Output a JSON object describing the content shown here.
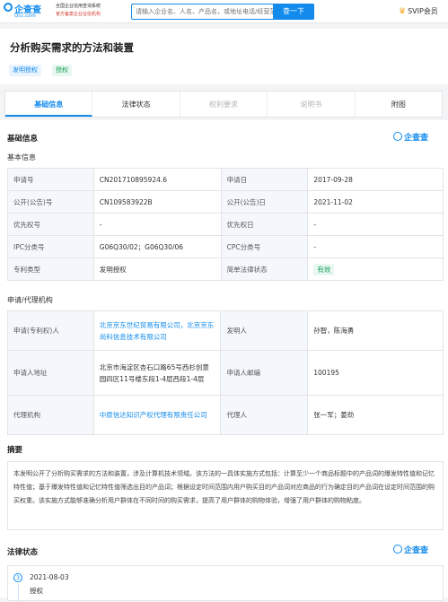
{
  "topbar": {
    "logo_text": "企查查",
    "logo_url": "Qcc.com",
    "slogan_line1": "全国企业信用查询系统",
    "slogan_line2": "官方备案企业征信机构",
    "search_placeholder": "请输入企业名、人名、产品名，或地址电话/经营范围",
    "search_button": "查一下",
    "vip_label": "SVIP会员"
  },
  "header": {
    "title": "分析购买需求的方法和装置",
    "tags": [
      "发明授权",
      "授权"
    ]
  },
  "tabs": [
    {
      "label": "基础信息"
    },
    {
      "label": "法律状态"
    },
    {
      "label": "权利要求"
    },
    {
      "label": "说明书"
    },
    {
      "label": "附图"
    }
  ],
  "basic": {
    "section_title": "基础信息",
    "brand": "企查查",
    "sub_title": "基本信息",
    "rows": [
      {
        "k1": "申请号",
        "v1": "CN201710895924.6",
        "k2": "申请日",
        "v2": "2017-09-28"
      },
      {
        "k1": "公开(公告)号",
        "v1": "CN109583922B",
        "k2": "公开(公告)日",
        "v2": "2021-11-02"
      },
      {
        "k1": "优先权号",
        "v1": "-",
        "k2": "优先权日",
        "v2": "-"
      },
      {
        "k1": "IPC分类号",
        "v1": "G06Q30/02；G06Q30/06",
        "k2": "CPC分类号",
        "v2": "-"
      },
      {
        "k1": "专利类型",
        "v1": "发明授权",
        "k2": "简单法律状态",
        "v2": "有效"
      }
    ]
  },
  "agency": {
    "sub_title": "申请/代理机构",
    "rows": [
      {
        "k1": "申请(专利权)人",
        "v1": "北京京东世纪贸易有限公司，北京京东尚科信息技术有限公司",
        "k2": "发明人",
        "v2": "孙智，陈海勇"
      },
      {
        "k1": "申请人地址",
        "v1": "北京市海淀区杏石口路65号西杉创意园四区11号楼东段1-4层西段1-4层",
        "k2": "申请人邮编",
        "v2": "100195"
      },
      {
        "k1": "代理机构",
        "v1": "中原信达知识产权代理有限责任公司",
        "k2": "代理人",
        "v2": "张一军；姜劲"
      }
    ]
  },
  "abstract": {
    "title": "摘要",
    "text": "本发明公开了分析购买需求的方法和装置，涉及计算机技术领域。该方法的一具体实施方式包括：计算至少一个商品标题中的产品词的爆发特性值和记忆特性值；基于爆发特性值和记忆特性值筛选出目的产品词；根据设定时间范围内用户购买目的产品词对应商品的行为确定目的产品词在设定时间范围的购买权重。该实施方式能够准确分析用户群体在不同时间的购买需求，提高了用户群体的购物体验，增强了用户群体的购物粘度。"
  },
  "legal": {
    "title": "法律状态",
    "brand": "企查查",
    "events": [
      {
        "num": "3",
        "date": "2021-08-03",
        "status": "授权"
      }
    ]
  }
}
